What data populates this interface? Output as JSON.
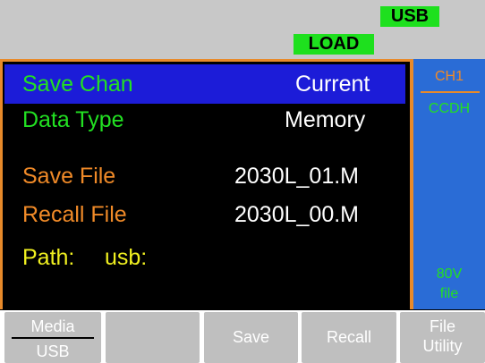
{
  "status": {
    "usb_badge": "USB",
    "load_badge": "LOAD"
  },
  "save_settings": {
    "save_chan": {
      "label": "Save Chan",
      "value": "Current",
      "selected": true
    },
    "data_type": {
      "label": "Data Type",
      "value": "Memory"
    }
  },
  "files": {
    "save_file": {
      "label": "Save File",
      "value": "2030L_01.M"
    },
    "recall_file": {
      "label": "Recall File",
      "value": "2030L_00.M"
    },
    "path": {
      "label": "Path:",
      "value": "usb:"
    }
  },
  "side_panel": {
    "channel": "CH1",
    "mode": "CCDH",
    "voltage": "80V",
    "type": "file"
  },
  "softkeys": {
    "media": {
      "top": "Media",
      "bottom": "USB"
    },
    "blank": "",
    "save": "Save",
    "recall": "Recall",
    "file_utility": {
      "top": "File",
      "bottom": "Utility"
    }
  },
  "colors": {
    "accent_orange": "#e88a2a",
    "selection_blue": "#1c1cd8",
    "side_blue": "#2a6cd6",
    "label_green": "#22e022",
    "label_orange": "#f08a28",
    "label_yellow": "#f0f020"
  }
}
